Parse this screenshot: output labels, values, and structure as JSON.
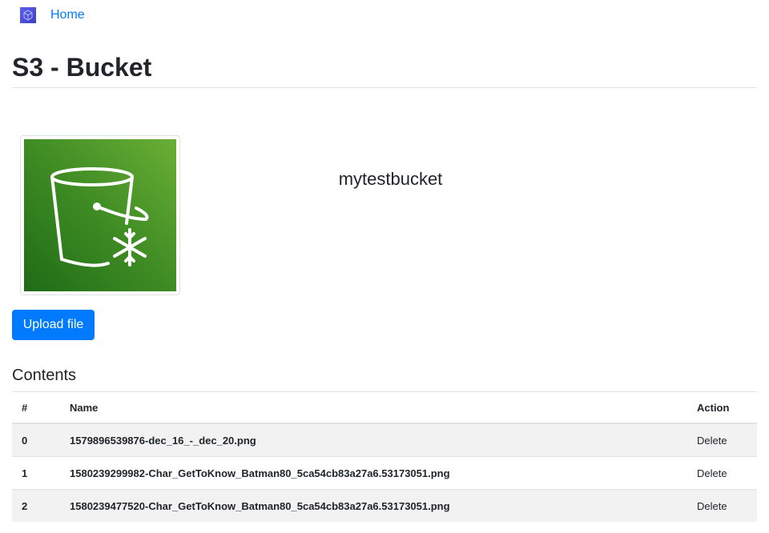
{
  "nav": {
    "logo_icon": "cube-logo-icon",
    "home_label": "Home"
  },
  "page": {
    "title": "S3 - Bucket"
  },
  "bucket": {
    "name": "mytestbucket",
    "image_icon": "s3-glacier-bucket-icon",
    "upload_label": "Upload file"
  },
  "contents": {
    "heading": "Contents",
    "columns": [
      "#",
      "Name",
      "Action"
    ],
    "rows": [
      {
        "index": "0",
        "name": "1579896539876-dec_16_-_dec_20.png",
        "action": "Delete"
      },
      {
        "index": "1",
        "name": "1580239299982-Char_GetToKnow_Batman80_5ca54cb83a27a6.53173051.png",
        "action": "Delete"
      },
      {
        "index": "2",
        "name": "1580239477520-Char_GetToKnow_Batman80_5ca54cb83a27a6.53173051.png",
        "action": "Delete"
      }
    ]
  },
  "colors": {
    "primary": "#007bff",
    "stripe": "#f2f2f2",
    "bucket_green": "#3f8c24"
  }
}
